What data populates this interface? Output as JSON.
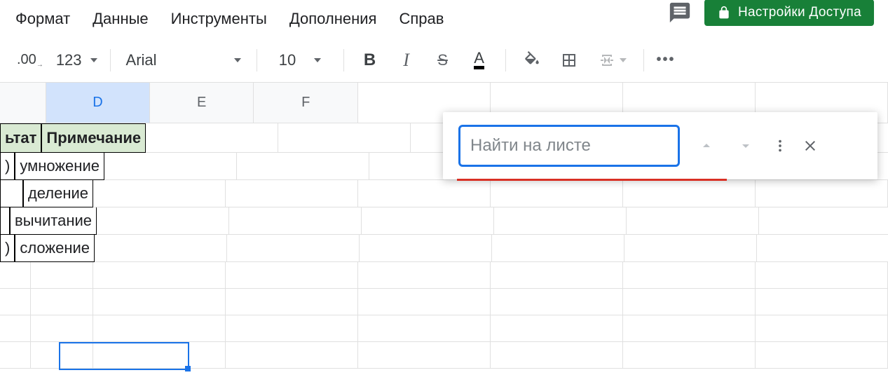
{
  "menu": {
    "format": "Формат",
    "data": "Данные",
    "tools": "Инструменты",
    "addons": "Дополнения",
    "help": "Справ"
  },
  "share": {
    "label": "Настройки Доступа"
  },
  "toolbar": {
    "decimal": ".00",
    "number_format": "123",
    "font": "Arial",
    "font_size": "10",
    "bold": "B",
    "italic": "I",
    "strike": "S",
    "textcolor": "A"
  },
  "columns": {
    "d": "D",
    "e": "E",
    "f": "F"
  },
  "table": {
    "header_c": "ьтат",
    "header_d": "Примечание",
    "rows": [
      {
        "c": ")",
        "d": "умножение"
      },
      {
        "c": "",
        "d": "деление"
      },
      {
        "c": "",
        "d": "вычитание"
      },
      {
        "c": ")",
        "d": "сложение"
      }
    ]
  },
  "find": {
    "placeholder": "Найти на листе"
  }
}
